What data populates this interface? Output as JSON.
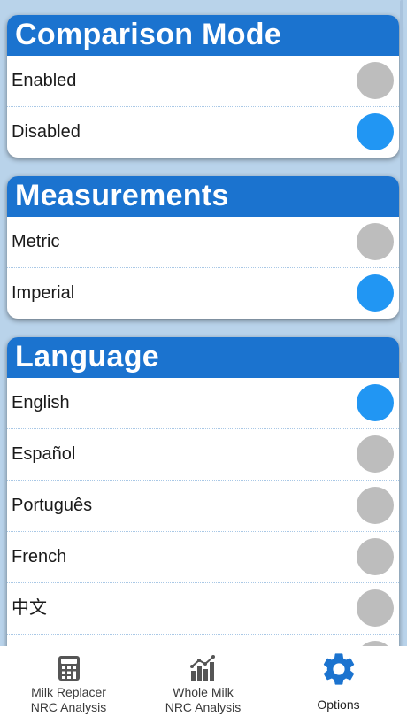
{
  "comparison": {
    "title": "Comparison Mode",
    "options": [
      {
        "label": "Enabled",
        "selected": false
      },
      {
        "label": "Disabled",
        "selected": true
      }
    ]
  },
  "measurements": {
    "title": "Measurements",
    "options": [
      {
        "label": "Metric",
        "selected": false
      },
      {
        "label": "Imperial",
        "selected": true
      }
    ]
  },
  "language": {
    "title": "Language",
    "options": [
      {
        "label": "English",
        "selected": true
      },
      {
        "label": "Español",
        "selected": false
      },
      {
        "label": "Português",
        "selected": false
      },
      {
        "label": "French",
        "selected": false
      },
      {
        "label": "中文",
        "selected": false
      },
      {
        "label": "",
        "selected": false
      }
    ]
  },
  "nav": {
    "items": [
      {
        "line1": "Milk Replacer",
        "line2": "NRC Analysis",
        "icon": "calculator-icon"
      },
      {
        "line1": "Whole Milk",
        "line2": "NRC Analysis",
        "icon": "chart-icon"
      },
      {
        "label": "Options",
        "icon": "gear-icon",
        "active": true
      }
    ]
  },
  "colors": {
    "header": "#1b73cf",
    "radio_on": "#2196f3",
    "radio_off": "#bdbdbd",
    "active_tab": "#1b73cf"
  }
}
